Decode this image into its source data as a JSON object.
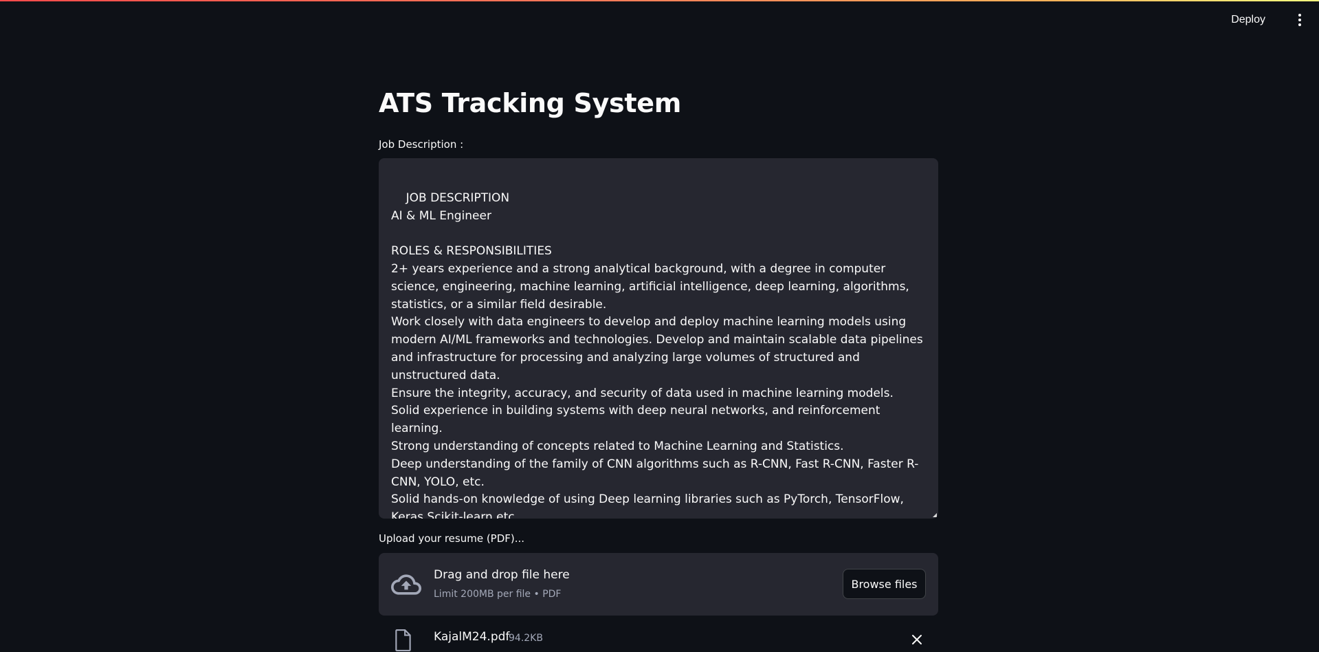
{
  "header": {
    "deploy_label": "Deploy",
    "menu_icon": "vertical-ellipsis-icon"
  },
  "main": {
    "title": "ATS Tracking System",
    "job_description": {
      "label": "Job Description :",
      "value": "JOB DESCRIPTION\nAI & ML Engineer\n\nROLES & RESPONSIBILITIES\n2+ years experience and a strong analytical background, with a degree in computer science, engineering, machine learning, artificial intelligence, deep learning, algorithms, statistics, or a similar field desirable.\nWork closely with data engineers to develop and deploy machine learning models using modern AI/ML frameworks and technologies. Develop and maintain scalable data pipelines and infrastructure for processing and analyzing large volumes of structured and unstructured data.\nEnsure the integrity, accuracy, and security of data used in machine learning models.\nSolid experience in building systems with deep neural networks, and reinforcement learning.\nStrong understanding of concepts related to Machine Learning and Statistics.\nDeep understanding of the family of CNN algorithms such as R-CNN, Fast R-CNN, Faster R-CNN, YOLO, etc.\nSolid hands-on knowledge of using Deep learning libraries such as PyTorch, TensorFlow, Keras,Scikit-learn etc.\nProficiency in the implementation of algorithms and the use of advanced data structures to solve problems in computing. A solid foundation in the principles of computer science is desired."
    },
    "uploader": {
      "label": "Upload your resume (PDF)...",
      "drop_title": "Drag and drop file here",
      "limit_text": "Limit 200MB per file • PDF",
      "browse_label": "Browse files",
      "icon": "cloud-upload-icon"
    },
    "uploaded_file": {
      "name": "KajalM24.pdf",
      "size": "94.2KB",
      "icon": "file-icon"
    }
  },
  "colors": {
    "background": "#0e1117",
    "surface": "#262730",
    "text": "#fafafa",
    "muted_text": "#a3a8b8",
    "accent_gradient_start": "#ff4b4b",
    "accent_gradient_end": "#fffd80"
  }
}
